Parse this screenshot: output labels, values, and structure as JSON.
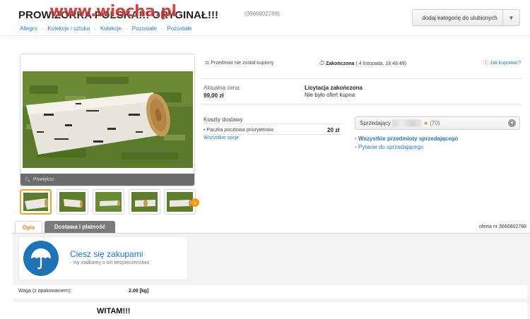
{
  "header": {
    "title": "PROWIZORKA POLSKA!!! ORYGINAŁ!!!",
    "offer_id": "(3666802788)",
    "watermark": "www.wiocha.pl",
    "favorite_button": "dodaj kategorię do ulubionych",
    "breadcrumb": [
      "Allegro",
      "Kolekcje i sztuka",
      "Kolekcje",
      "Pozostałe",
      "Pozostałe"
    ]
  },
  "gallery": {
    "zoom_label": "Powiększ",
    "thumbnail_count": 5
  },
  "status": {
    "not_bought": "Przedmiot nie został kupiony",
    "ended_label": "Zakończona",
    "ended_date": "( 4 listopada, 18:48:49)",
    "help_link": "Jak kupować?"
  },
  "price": {
    "label": "Aktualna cena",
    "value": "99,00 zł",
    "auction_status": "Licytacja zakończona",
    "no_offers": "Nie było ofert kupna"
  },
  "shipping": {
    "title": "Koszty dostawy",
    "method": "Paczka pocztowa priorytetowa",
    "cost": "20 zł",
    "all_options": "Wszystkie opcje"
  },
  "seller": {
    "label": "Sprzedający",
    "rating": "(70)",
    "all_items": "Wszystkie przedmioty sprzedającego",
    "ask": "Pytanie do sprzedającego"
  },
  "tabs": {
    "description": "Opis",
    "delivery": "Dostawa i płatność",
    "offer_number": "oferta nr 3666802788"
  },
  "promo": {
    "title": "Ciesz się zakupami",
    "subtitle": "my zadbamy o ich bezpieczeństwo"
  },
  "details": {
    "weight_label": "Waga (z opakowaniem):",
    "weight_value": "2.00 [kg]",
    "greeting": "WITAM!!!"
  },
  "colors": {
    "link": "#2a7ab8",
    "accent_orange": "#e8841a",
    "umbrella_blue": "#1f73b7"
  }
}
